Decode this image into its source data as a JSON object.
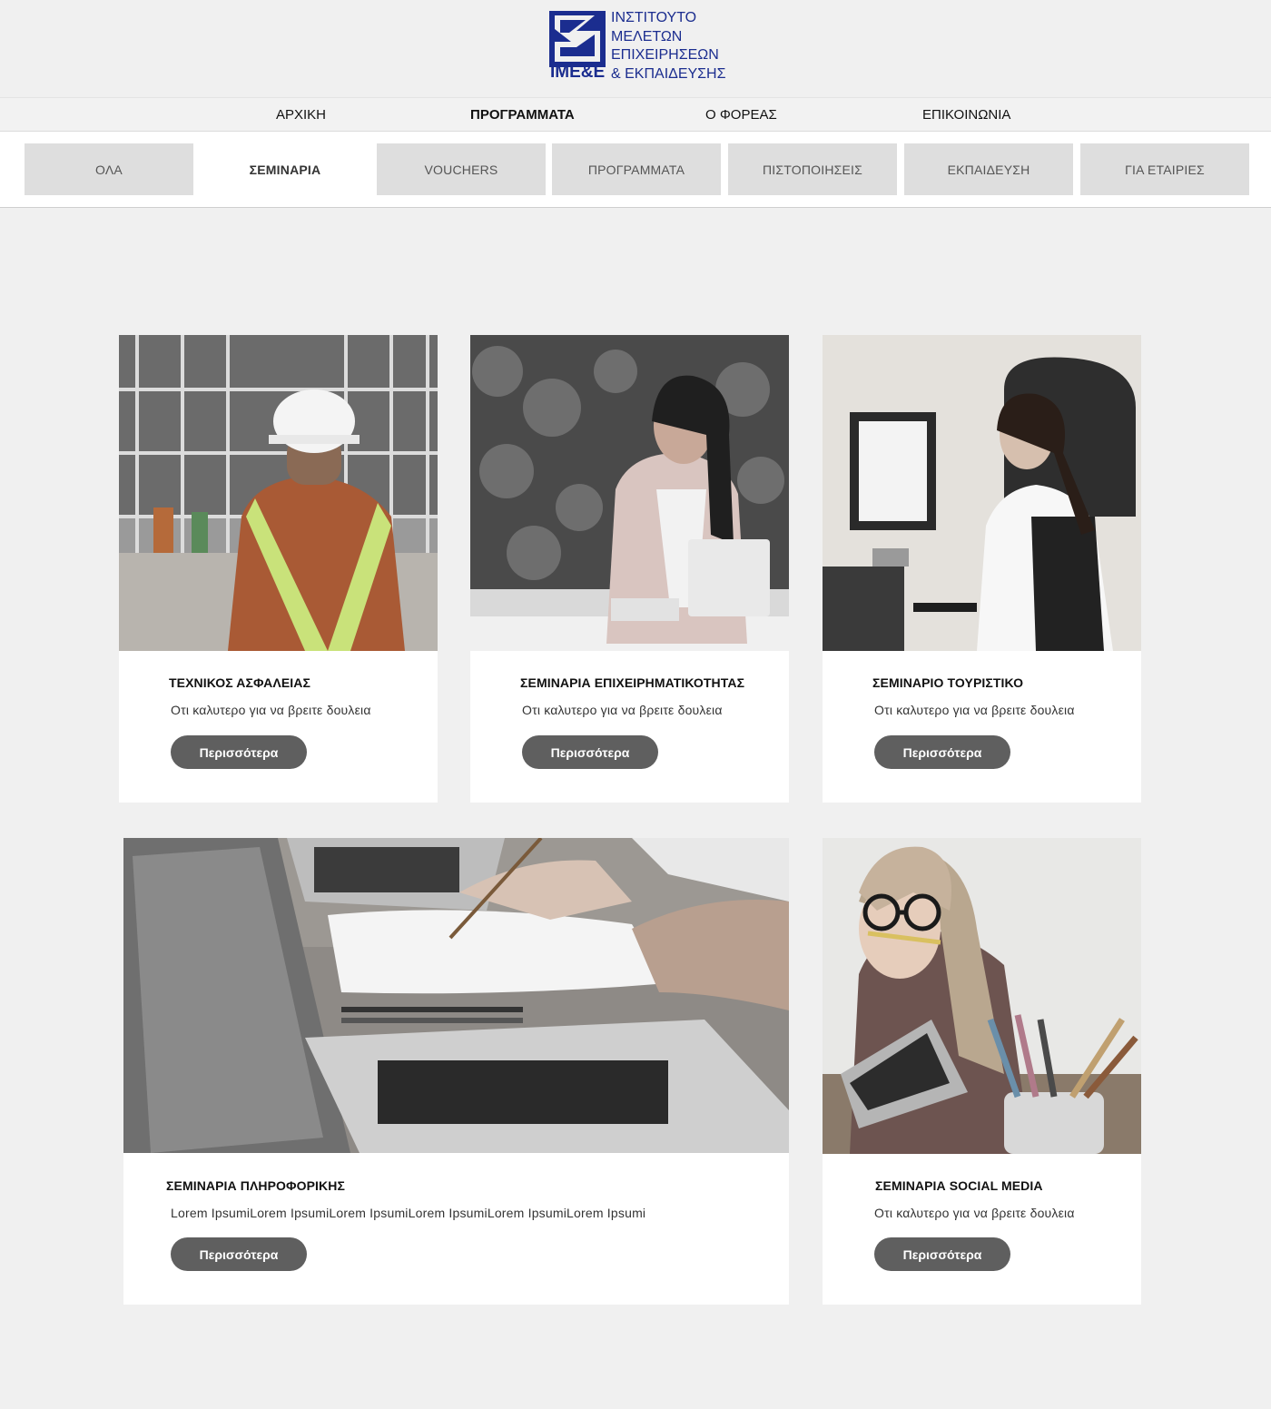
{
  "logo": {
    "abbr": "IME&E",
    "line1": "ΙΝΣΤΙΤΟΥΤΟ",
    "line2": "ΜΕΛΕΤΩΝ",
    "line3": "ΕΠΙΧΕΙΡΗΣΕΩΝ",
    "line4": "& ΕΚΠΑΙΔΕΥΣΗΣ",
    "color": "#1b2d8f"
  },
  "nav": {
    "items": [
      {
        "label": "ΑΡΧΙΚΗ"
      },
      {
        "label": "ΠΡΟΓΡΑΜΜΑΤΑ"
      },
      {
        "label": "Ο ΦΟΡΕΑΣ"
      },
      {
        "label": "ΕΠΙΚΟΙΝΩΝΙΑ"
      }
    ],
    "active": "ΠΡΟΓΡΑΜΜΑΤΑ"
  },
  "filters": {
    "items": [
      {
        "label": "ΟΛΑ"
      },
      {
        "label": "ΣΕΜΙΝΑΡΙΑ"
      },
      {
        "label": "VOUCHERS"
      },
      {
        "label": "ΠΡΟΓΡΑΜΜΑΤΑ"
      },
      {
        "label": "ΠΙΣΤΟΠΟΙΗΣΕΙΣ"
      },
      {
        "label": "ΕΚΠΑΙΔΕΥΣΗ"
      },
      {
        "label": "ΓΙΑ ΕΤΑΙΡΙΕΣ"
      }
    ],
    "active": "ΣΕΜΙΝΑΡΙΑ"
  },
  "cards": [
    {
      "title": "ΤΕΧΝΙΚΟΣ ΑΣΦΑΛΕΙΑΣ",
      "description": "Οτι καλυτερο για να βρειτε δουλεια",
      "button": "Περισσότερα"
    },
    {
      "title": "ΣΕΜΙΝΑΡΙΑ ΕΠΙΧΕΙΡΗΜΑΤΙΚΟΤΗΤΑΣ",
      "description": "Οτι καλυτερο για να βρειτε δουλεια",
      "button": "Περισσότερα"
    },
    {
      "title": "ΣΕΜΙΝΑΡΙΟ ΤΟΥΡΙΣΤΙΚΟ",
      "description": "Οτι καλυτερο για να βρειτε δουλεια",
      "button": "Περισσότερα"
    },
    {
      "title": "ΣΕΜΙΝΑΡΙΑ ΠΛΗΡΟΦΟΡΙΚΗΣ",
      "description": "Lorem IpsumiLorem IpsumiLorem IpsumiLorem IpsumiLorem IpsumiLorem Ipsumi",
      "button": "Περισσότερα"
    },
    {
      "title": "ΣΕΜΙΝΑΡΙΑ SOCIAL MEDIA",
      "description": "Οτι καλυτερο για να βρειτε δουλεια",
      "button": "Περισσότερα"
    }
  ],
  "colors": {
    "background": "#f0f0f0",
    "button": "#5f5f5f",
    "tab_inactive": "#dedede",
    "tab_active": "#ffffff"
  }
}
